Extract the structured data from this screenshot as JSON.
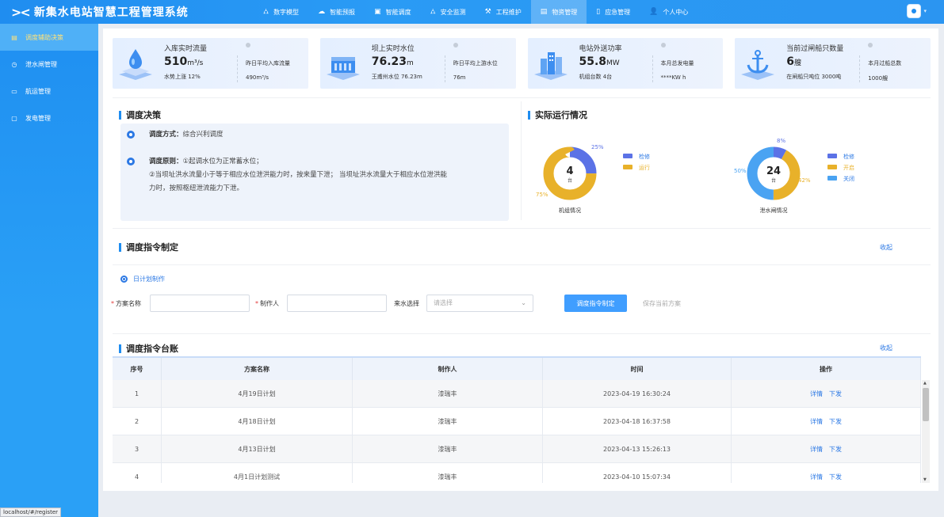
{
  "app": {
    "logo_mark": "><",
    "title": "新集水电站智慧工程管理系统"
  },
  "nav": [
    {
      "label": "数字模型",
      "icon": "hierarchy-icon",
      "glyph": "⛼"
    },
    {
      "label": "智能预报",
      "icon": "cloud-icon",
      "glyph": "☁"
    },
    {
      "label": "智能调度",
      "icon": "monitor-icon",
      "glyph": "▣"
    },
    {
      "label": "安全监测",
      "icon": "hierarchy-icon",
      "glyph": "⛼"
    },
    {
      "label": "工程维护",
      "icon": "tool-icon",
      "glyph": "⚒"
    },
    {
      "label": "物资管理",
      "icon": "box-icon",
      "glyph": "▤"
    },
    {
      "label": "应急管理",
      "icon": "phone-icon",
      "glyph": "▯"
    },
    {
      "label": "个人中心",
      "icon": "user-icon",
      "glyph": "👤"
    }
  ],
  "nav_active_index": 5,
  "sidebar": [
    {
      "label": "调度辅助决策",
      "glyph": "▤"
    },
    {
      "label": "泄水闸管理",
      "glyph": "◷"
    },
    {
      "label": "航运管理",
      "glyph": "▭"
    },
    {
      "label": "发电管理",
      "glyph": "▢"
    }
  ],
  "status_url": "localhost/#/register",
  "stats": [
    {
      "title": "入库实时流量",
      "value": "510",
      "unit": "m³/s",
      "sub": "水势上涨 12%",
      "label2": "昨日平均入库流量",
      "value2": "490m³/s",
      "icon": "water-drop-icon"
    },
    {
      "title": "坝上实时水位",
      "value": "76.23",
      "unit": "m",
      "sub": "王甫州水位 76.23m",
      "label2": "昨日平均上游水位",
      "value2": "76m",
      "icon": "dam-icon"
    },
    {
      "title": "电站外送功率",
      "value": "55.8",
      "unit": "MW",
      "sub": "机组台数 4台",
      "label2": "本月总发电量",
      "value2": "****KW h",
      "icon": "power-station-icon"
    },
    {
      "title": "当前过闸船只数量",
      "value": "6",
      "unit": "艘",
      "sub": "在闸船只吨位 3000吨",
      "label2": "本月过船总数",
      "value2": "1000艘",
      "icon": "anchor-icon"
    }
  ],
  "decision": {
    "title": "调度决策",
    "method_label": "调度方式：",
    "method_value": "综合兴利调度",
    "principle_label": "调度原则：",
    "principle_line1": "①起调水位为正常蓄水位；",
    "principle_line2": "②当坝址洪水流量小于等于相应水位泄洪能力时，按来量下泄； 当坝址洪水流量大于相应水位泄洪能",
    "principle_line3": "力时，按照枢纽泄流能力下泄。"
  },
  "actual": {
    "title": "实际运行情况"
  },
  "chart_data": [
    {
      "type": "pie",
      "title": "机组情况",
      "center_value": "4",
      "center_unit": "台",
      "categories": [
        "检修",
        "运行"
      ],
      "values": [
        25,
        75
      ],
      "labels": [
        "25%",
        "75%"
      ],
      "colors": [
        "#5b72e6",
        "#e8b12a"
      ]
    },
    {
      "type": "pie",
      "title": "泄水闸情况",
      "center_value": "24",
      "center_unit": "台",
      "categories": [
        "检修",
        "开启",
        "关闭"
      ],
      "values": [
        8,
        42,
        50
      ],
      "labels": [
        "8%",
        "42%",
        "50%"
      ],
      "colors": [
        "#5b72e6",
        "#e8b12a",
        "#4aa3f2"
      ]
    }
  ],
  "command": {
    "title": "调度指令制定",
    "collapse": "收起",
    "radio_label": "日计划制作",
    "plan_name_label": "方案名称",
    "maker_label": "制作人",
    "water_label": "来水选择",
    "water_placeholder": "请选择",
    "submit": "调度指令制定",
    "save": "保存当前方案",
    "required_mark": "*"
  },
  "ledger": {
    "title": "调度指令台账",
    "collapse": "收起",
    "headers": [
      "序号",
      "方案名称",
      "制作人",
      "时间",
      "操作"
    ],
    "action_detail": "详情",
    "action_send": "下发",
    "rows": [
      [
        "1",
        "4月19日计划",
        "漆瑞丰",
        "2023-04-19 16:30:24"
      ],
      [
        "2",
        "4月18日计划",
        "漆瑞丰",
        "2023-04-18 16:37:58"
      ],
      [
        "3",
        "4月13日计划",
        "漆瑞丰",
        "2023-04-13 15:26:13"
      ],
      [
        "4",
        "4月1日计划测试",
        "漆瑞丰",
        "2023-04-10 15:07:34"
      ]
    ]
  }
}
